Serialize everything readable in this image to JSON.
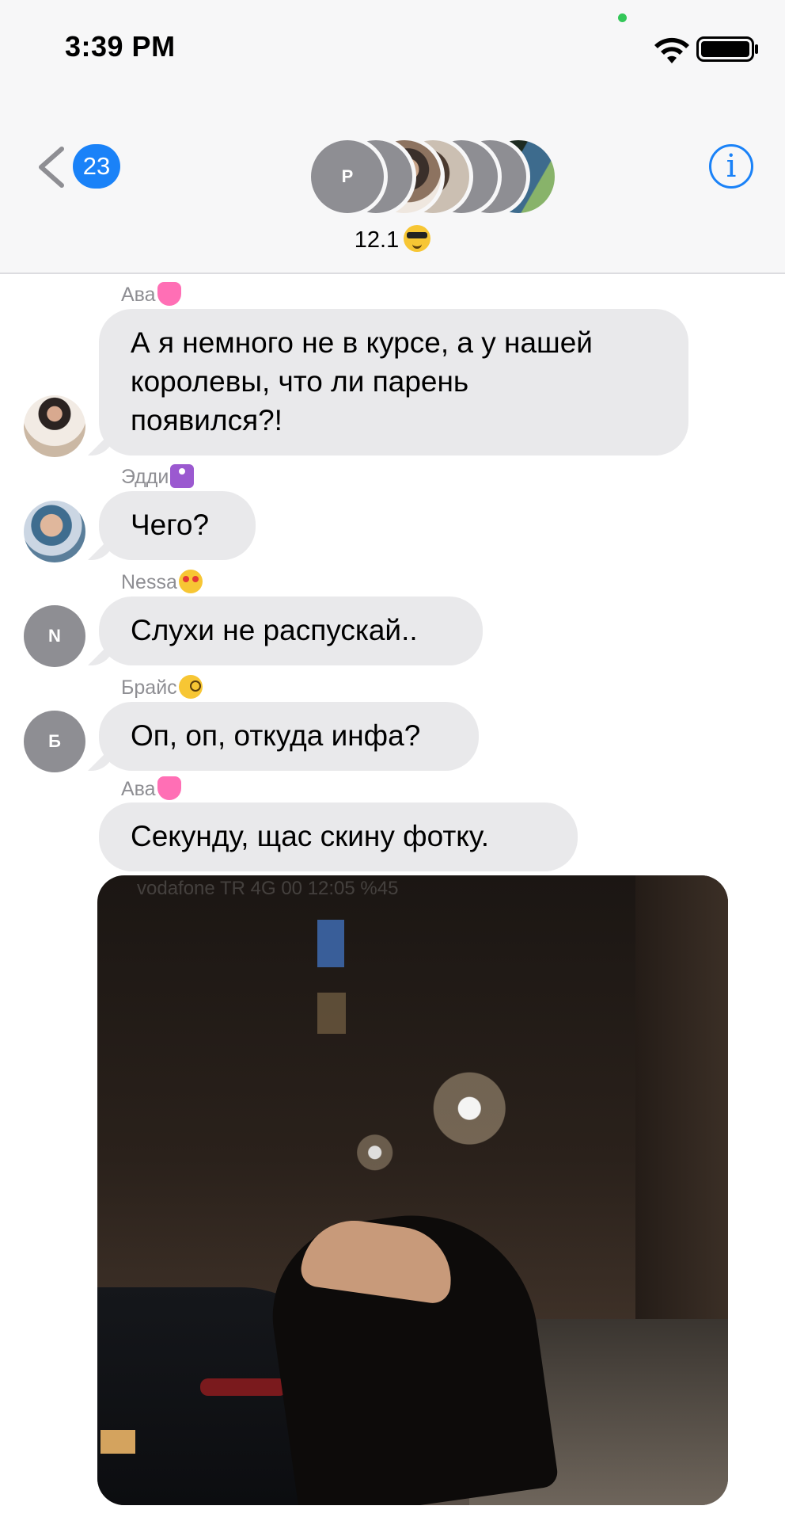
{
  "status_bar": {
    "time": "3:39 PM"
  },
  "nav": {
    "back_count": "23",
    "group_first_initial": "P",
    "group_name": "12.1",
    "group_emoji": "sunglasses-face-icon"
  },
  "messages": [
    {
      "sender": "Ава",
      "sender_emoji": "pink-heart-icon",
      "text_lines": [
        "А я немного не в курсе, а у нашей",
        "королевы, что ли парень",
        "появился?!"
      ],
      "avatar": "photo"
    },
    {
      "sender": "Эдди",
      "sender_emoji": "woman-symbol-icon",
      "text_lines": [
        "Чего?"
      ],
      "avatar": "photo"
    },
    {
      "sender": "Nessa",
      "sender_emoji": "heart-eyes-face-icon",
      "text_lines": [
        "Слухи не распускай.."
      ],
      "avatar_initial": "N"
    },
    {
      "sender": "Брайс",
      "sender_emoji": "monocle-face-icon",
      "text_lines": [
        "Оп, оп, откуда инфа?"
      ],
      "avatar_initial": "Б"
    },
    {
      "sender": "Ава",
      "sender_emoji": "pink-heart-icon",
      "text_lines": [
        "Секунду, щас скину фотку."
      ]
    }
  ],
  "photo_overlay_text": "vodafone TR  4G          00 12:05          %45",
  "colors": {
    "accent": "#1a82f8",
    "bubble_received": "#e9e9eb",
    "sender_label": "#8e8e93",
    "header_bg": "#f7f7f8"
  }
}
